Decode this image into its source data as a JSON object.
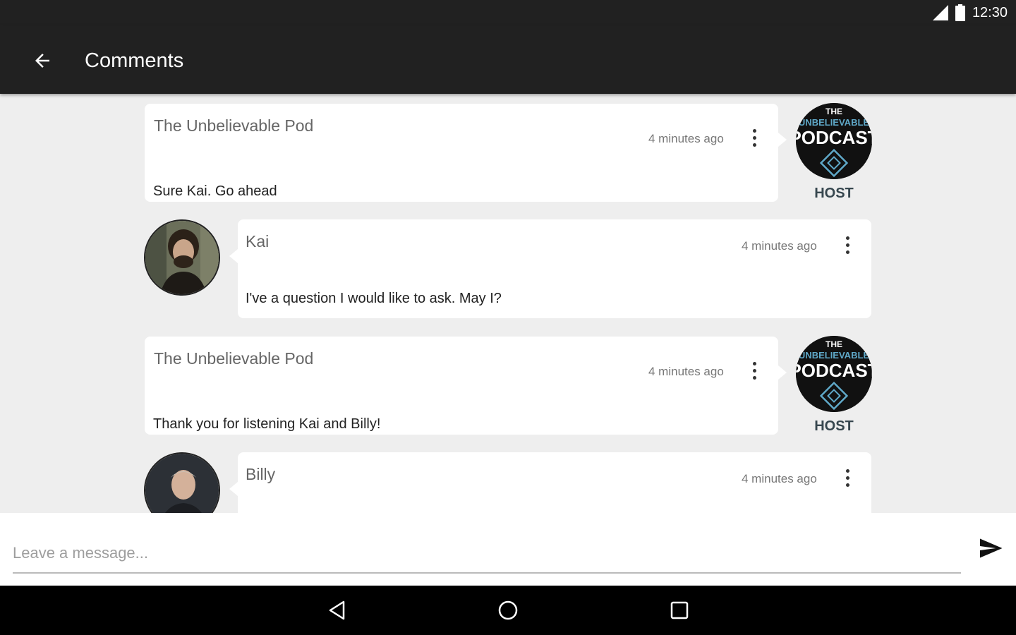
{
  "status_bar": {
    "time": "12:30",
    "icons": [
      "signal-icon",
      "battery-icon"
    ]
  },
  "app_bar": {
    "title": "Comments",
    "back_icon": "arrow-left-icon"
  },
  "comments": [
    {
      "author": "The Unbelievable Pod",
      "time": "4 minutes ago",
      "text": "Sure Kai. Go ahead",
      "role": "HOST",
      "side": "right"
    },
    {
      "author": "Kai",
      "time": "4 minutes ago",
      "text": "I've a question I would like to ask. May I?",
      "side": "left"
    },
    {
      "author": "The Unbelievable Pod",
      "time": "4 minutes ago",
      "text": "Thank you for listening Kai and Billy!",
      "role": "HOST",
      "side": "right"
    },
    {
      "author": "Billy",
      "time": "4 minutes ago",
      "text": "",
      "side": "left"
    }
  ],
  "host_logo": {
    "line1": "THE",
    "line2": "UNBELIEVABLE",
    "line3": "PODCAST"
  },
  "composer": {
    "placeholder": "Leave a message...",
    "value": "",
    "send_icon": "send-icon"
  },
  "nav_bar": {
    "icons": [
      "back-triangle-icon",
      "home-circle-icon",
      "recents-square-icon"
    ]
  },
  "colors": {
    "bar": "#212121",
    "background": "#eeeeee",
    "bubble": "#ffffff",
    "host_label": "#37474f",
    "logo_accent": "#5fa8c8"
  }
}
